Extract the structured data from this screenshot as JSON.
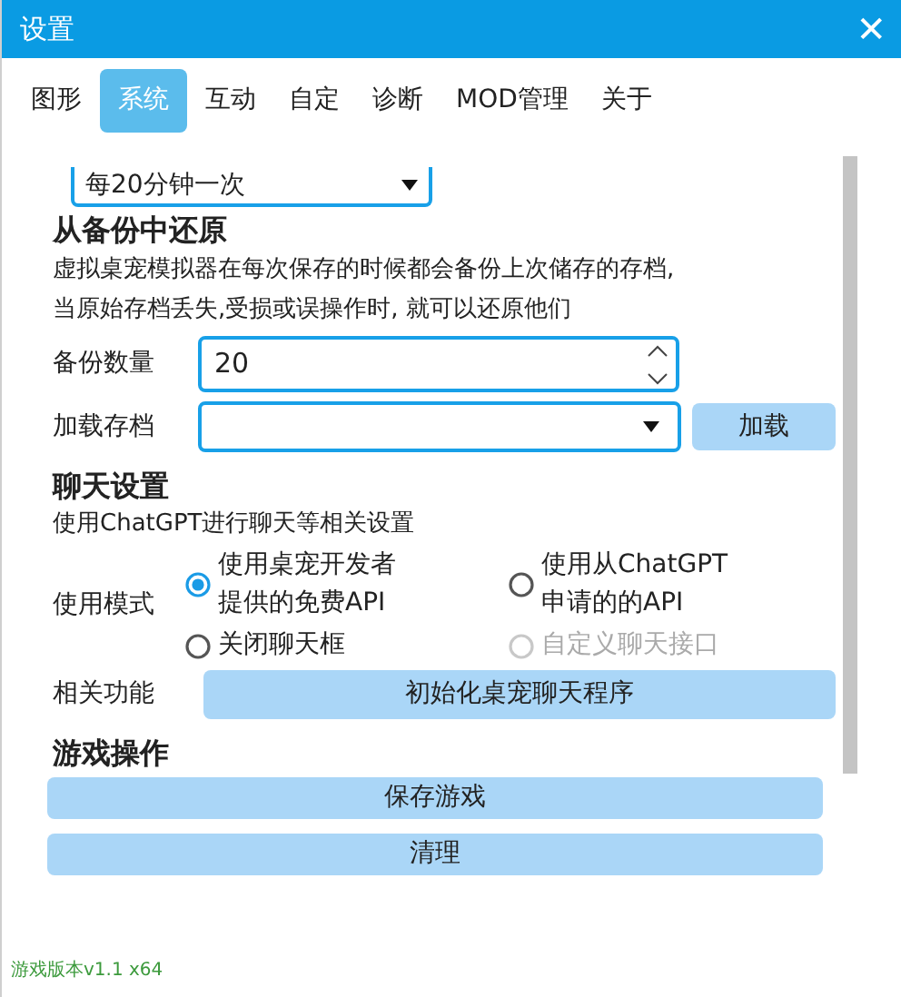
{
  "window": {
    "title": "设置",
    "close": "✕"
  },
  "tabs": [
    {
      "label": "图形",
      "selected": false
    },
    {
      "label": "系统",
      "selected": true
    },
    {
      "label": "互动",
      "selected": false
    },
    {
      "label": "自定",
      "selected": false
    },
    {
      "label": "诊断",
      "selected": false
    },
    {
      "label": "MOD管理",
      "selected": false
    },
    {
      "label": "关于",
      "selected": false
    }
  ],
  "backup_interval": {
    "value": "每20分钟一次"
  },
  "restore": {
    "title": "从备份中还原",
    "description": "虚拟桌宠模拟器在每次保存的时候都会备份上次储存的存档,\n当原始存档丢失,受损或误操作时, 就可以还原他们",
    "count_label": "备份数量",
    "count_value": "20",
    "load_label": "加载存档",
    "load_button": "加载"
  },
  "chat": {
    "title": "聊天设置",
    "description": "使用ChatGPT进行聊天等相关设置",
    "mode_label": "使用模式",
    "modes": [
      {
        "label": "使用桌宠开发者提供的免费API",
        "selected": true,
        "disabled": false
      },
      {
        "label": "使用从ChatGPT申请的的API",
        "selected": false,
        "disabled": false
      },
      {
        "label": "关闭聊天框",
        "selected": false,
        "disabled": false
      },
      {
        "label": "自定义聊天接口",
        "selected": false,
        "disabled": true
      }
    ],
    "function_label": "相关功能",
    "function_button": "初始化桌宠聊天程序"
  },
  "game": {
    "title": "游戏操作",
    "buttons": [
      "保存游戏",
      "清理"
    ]
  },
  "version": "游戏版本v1.1 x64"
}
